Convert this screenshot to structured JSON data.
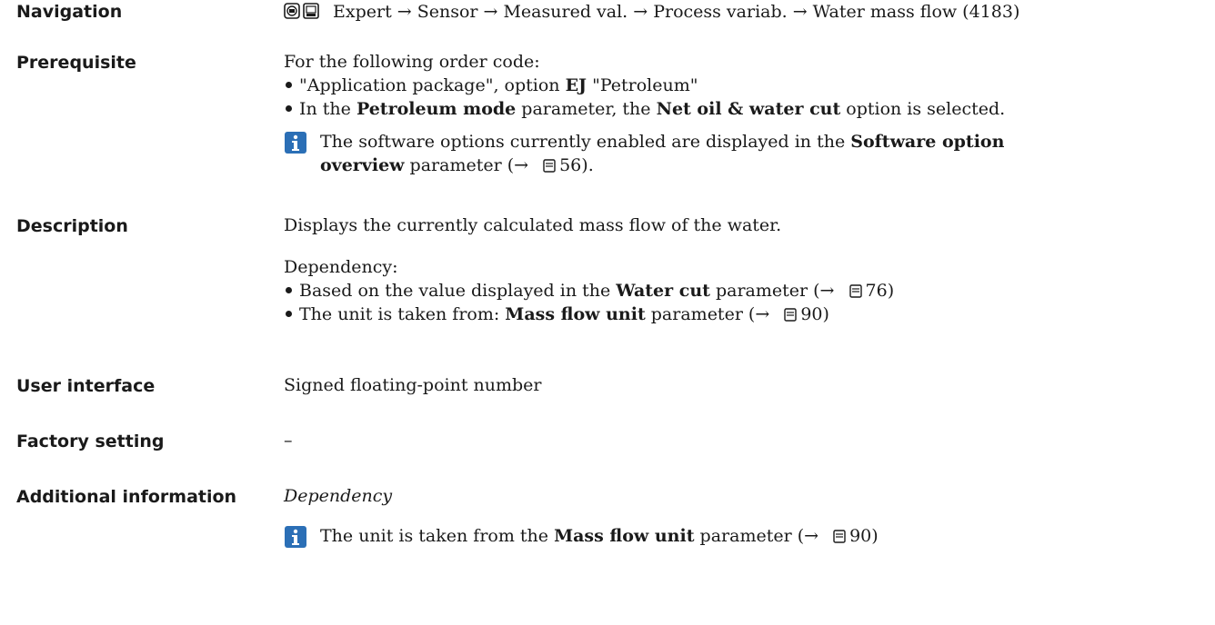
{
  "navigation": {
    "label": "Navigation",
    "icons": [
      "operating-display-icon",
      "display-module-icon"
    ],
    "path": "Expert → Sensor → Measured val. → Process variab. → Water mass flow (4183)"
  },
  "prerequisite": {
    "label": "Prerequisite",
    "intro": "For the following order code:",
    "bullet1": {
      "pre": "\"Application package\", option ",
      "bold": "EJ",
      "post": " \"Petroleum\""
    },
    "bullet2": {
      "pre": "In the ",
      "bold1": "Petroleum mode",
      "mid": " parameter, the ",
      "bold2": "Net oil & water cut",
      "post": " option is selected."
    },
    "note": {
      "line1_pre": "The software options currently enabled are displayed in the ",
      "line1_bold": "Software option",
      "line2_bold": "overview",
      "line2_post": " parameter (→ ",
      "page": "56",
      "line2_end": ")."
    }
  },
  "description": {
    "label": "Description",
    "text": "Displays the currently calculated mass flow of the water.",
    "dependency_title": "Dependency:",
    "bullet1": {
      "pre": "Based on the value displayed in the ",
      "bold": "Water cut",
      "post": " parameter (→ ",
      "page": "76",
      "end": ")"
    },
    "bullet2": {
      "pre": "The unit is taken from: ",
      "bold": "Mass flow unit",
      "post": " parameter (→ ",
      "page": "90",
      "end": ")"
    }
  },
  "user_interface": {
    "label": "User interface",
    "value": "Signed floating-point number"
  },
  "factory_setting": {
    "label": "Factory setting",
    "value": "–"
  },
  "additional_information": {
    "label": "Additional information",
    "subheading": "Dependency",
    "note": {
      "pre": "The unit is taken from the ",
      "bold": "Mass flow unit",
      "post": " parameter (→ ",
      "page": "90",
      "end": ")"
    }
  },
  "colors": {
    "info_icon": "#2b6fb6",
    "text": "#1a1a1a"
  }
}
